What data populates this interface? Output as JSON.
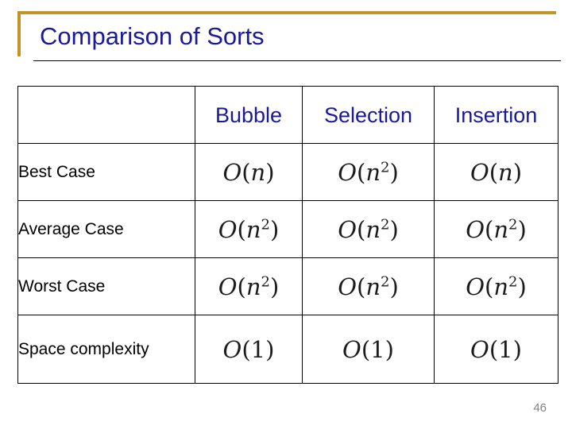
{
  "slide": {
    "title": "Comparison of Sorts",
    "page_number": "46",
    "accent_color": "#bf9428",
    "title_color": "#191999",
    "header_text_color": "#191999",
    "body_text_color": "#000000",
    "page_number_color": "#808080"
  },
  "table": {
    "corner_label": "",
    "columns": [
      {
        "key": "label",
        "header": ""
      },
      {
        "key": "bubble",
        "header": "Bubble"
      },
      {
        "key": "selection",
        "header": "Selection"
      },
      {
        "key": "insertion",
        "header": "Insertion"
      }
    ],
    "rows": [
      {
        "label": "Best Case",
        "bubble": {
          "base": "O",
          "open": "(",
          "arg": "n",
          "exp": "",
          "close": ")",
          "text": "O(n)"
        },
        "selection": {
          "base": "O",
          "open": "(",
          "arg": "n",
          "exp": "2",
          "close": ")",
          "text": "O(n^2)"
        },
        "insertion": {
          "base": "O",
          "open": "(",
          "arg": "n",
          "exp": "",
          "close": ")",
          "text": "O(n)"
        }
      },
      {
        "label": "Average Case",
        "bubble": {
          "base": "O",
          "open": "(",
          "arg": "n",
          "exp": "2",
          "close": ")",
          "text": "O(n^2)"
        },
        "selection": {
          "base": "O",
          "open": "(",
          "arg": "n",
          "exp": "2",
          "close": ")",
          "text": "O(n^2)"
        },
        "insertion": {
          "base": "O",
          "open": "(",
          "arg": "n",
          "exp": "2",
          "close": ")",
          "text": "O(n^2)"
        }
      },
      {
        "label": "Worst Case",
        "bubble": {
          "base": "O",
          "open": "(",
          "arg": "n",
          "exp": "2",
          "close": ")",
          "text": "O(n^2)"
        },
        "selection": {
          "base": "O",
          "open": "(",
          "arg": "n",
          "exp": "2",
          "close": ")",
          "text": "O(n^2)"
        },
        "insertion": {
          "base": "O",
          "open": "(",
          "arg": "n",
          "exp": "2",
          "close": ")",
          "text": "O(n^2)"
        }
      },
      {
        "label": "Space complexity",
        "bubble": {
          "base": "O",
          "open": "(",
          "arg": "1",
          "exp": "",
          "close": ")",
          "text": "O(1)"
        },
        "selection": {
          "base": "O",
          "open": "(",
          "arg": "1",
          "exp": "",
          "close": ")",
          "text": "O(1)"
        },
        "insertion": {
          "base": "O",
          "open": "(",
          "arg": "1",
          "exp": "",
          "close": ")",
          "text": "O(1)"
        }
      }
    ]
  }
}
